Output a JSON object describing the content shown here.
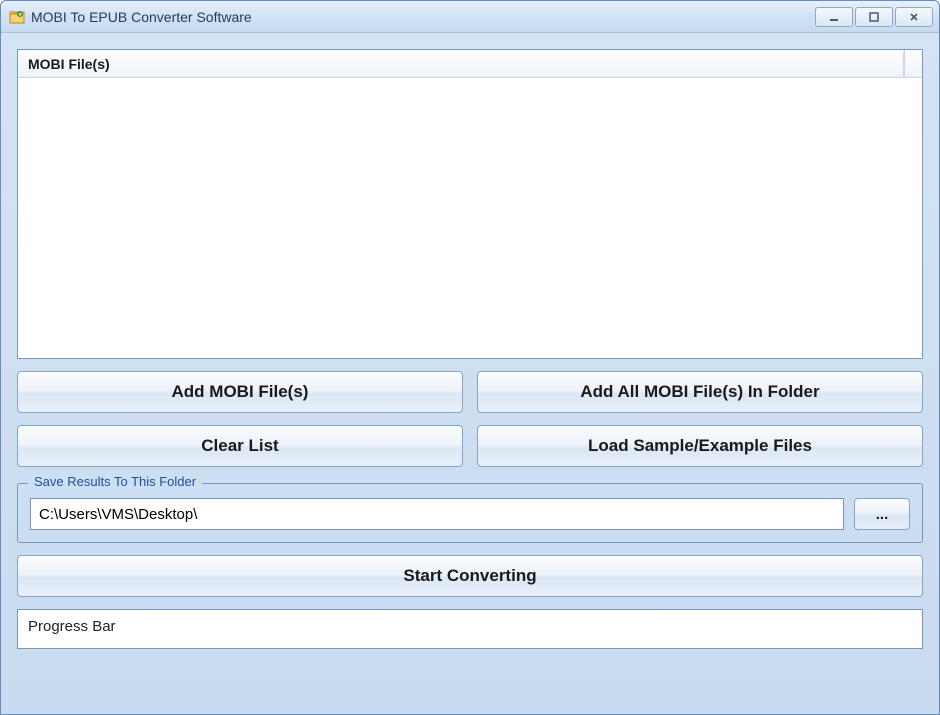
{
  "window": {
    "title": "MOBI To EPUB Converter Software"
  },
  "listHeader": {
    "column1": "MOBI File(s)"
  },
  "buttons": {
    "addFiles": "Add MOBI File(s)",
    "addFolder": "Add All MOBI File(s) In Folder",
    "clearList": "Clear List",
    "loadSample": "Load Sample/Example Files",
    "browse": "...",
    "start": "Start Converting"
  },
  "saveFolder": {
    "legend": "Save Results To This Folder",
    "path": "C:\\Users\\VMS\\Desktop\\"
  },
  "progress": {
    "label": "Progress Bar"
  }
}
